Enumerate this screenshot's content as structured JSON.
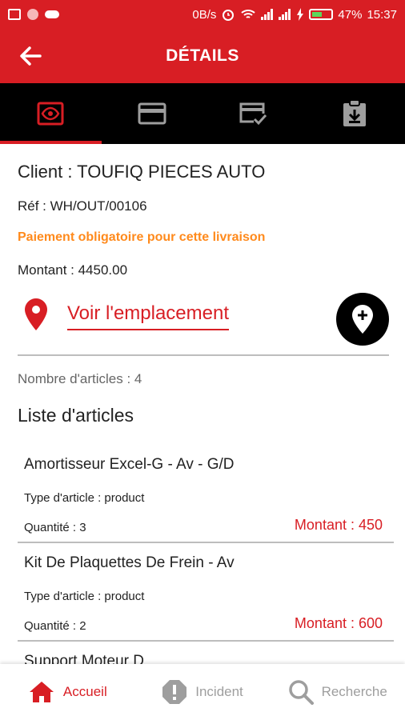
{
  "status_bar": {
    "network_speed": "0B/s",
    "battery_percent": "47%",
    "time": "15:37"
  },
  "header": {
    "title": "DÉTAILS"
  },
  "tabs": [
    {
      "icon": "eye-icon",
      "active": true
    },
    {
      "icon": "credit-card-icon",
      "active": false
    },
    {
      "icon": "checked-card-icon",
      "active": false
    },
    {
      "icon": "clipboard-download-icon",
      "active": false
    }
  ],
  "details": {
    "client": "Client : TOUFIQ PIECES AUTO",
    "ref": "Réf : WH/OUT/00106",
    "payment_warning": "Paiement obligatoire pour cette livraison",
    "montant": "Montant : 4450.00",
    "location_link": "Voir l'emplacement",
    "articles_count": "Nombre d'articles : 4",
    "articles_title": "Liste d'articles"
  },
  "articles": [
    {
      "name": "Amortisseur Excel-G - Av - G/D",
      "type": "Type d'article : product",
      "quantity": "Quantité : 3",
      "amount": "Montant : 450"
    },
    {
      "name": "Kit De Plaquettes De Frein - Av",
      "type": "Type d'article : product",
      "quantity": "Quantité : 2",
      "amount": "Montant : 600"
    },
    {
      "name": "Support Moteur D",
      "type": "",
      "quantity": "",
      "amount": ""
    }
  ],
  "bottom_nav": {
    "home": "Accueil",
    "incident": "Incident",
    "search": "Recherche"
  },
  "colors": {
    "primary": "#d81e24",
    "warning": "#ff8a1c",
    "tab_bar": "#000000",
    "inactive": "#9e9e9e"
  }
}
